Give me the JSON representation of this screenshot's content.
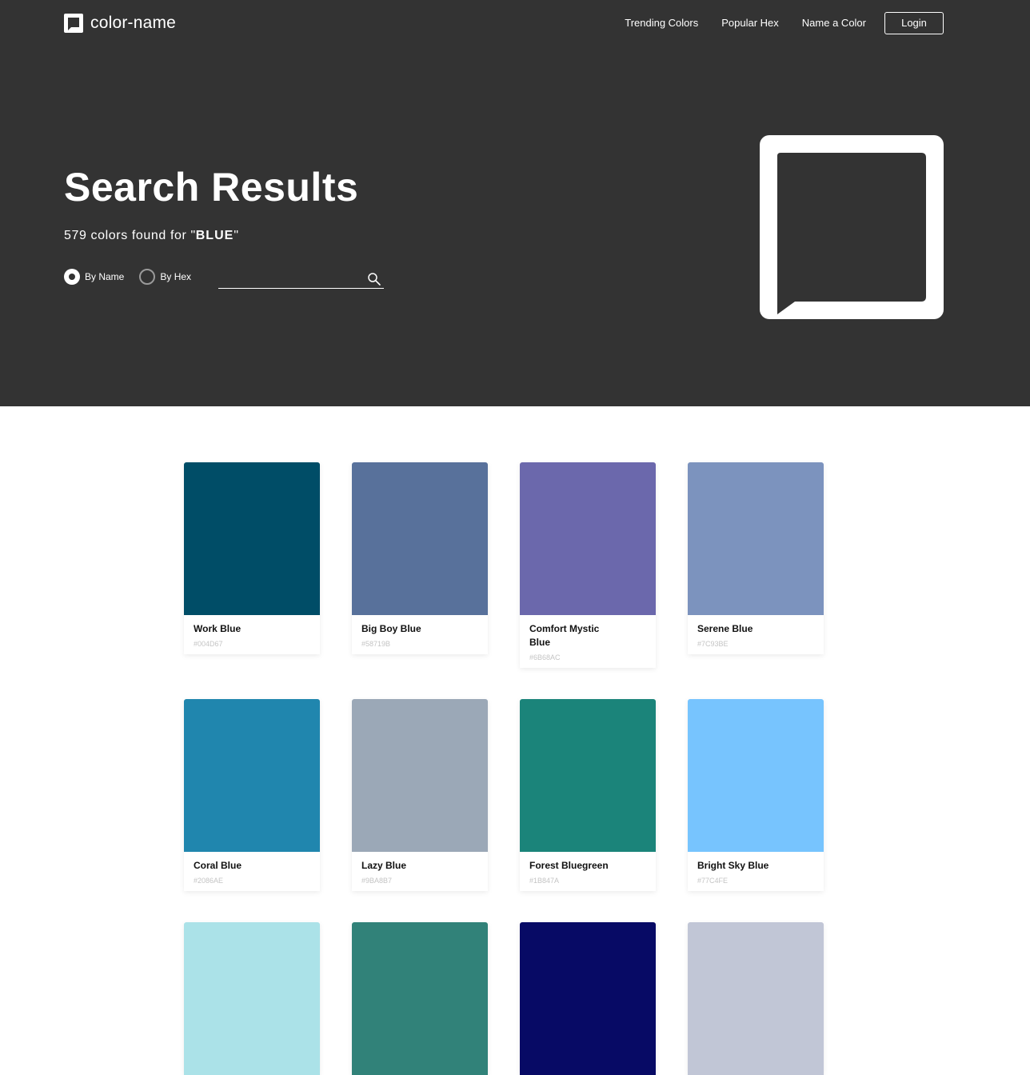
{
  "header": {
    "brand": "color-name",
    "nav": [
      "Trending Colors",
      "Popular Hex",
      "Name a Color"
    ],
    "login_label": "Login"
  },
  "hero": {
    "title": "Search Results",
    "summary_prefix": "579 colors found for \"",
    "query": "BLUE",
    "summary_suffix": "\"",
    "mode_options": [
      "By Name",
      "By Hex"
    ],
    "selected_mode": "By Name",
    "search_value": "",
    "search_placeholder": ""
  },
  "colors": [
    {
      "name": "Work Blue",
      "hex": "#004D67",
      "swatch": "#004d67"
    },
    {
      "name": "Big Boy Blue",
      "hex": "#58719B",
      "swatch": "#58719b"
    },
    {
      "name": "Comfort Mystic Blue",
      "hex": "#6B68AC",
      "swatch": "#6b68ac"
    },
    {
      "name": "Serene Blue",
      "hex": "#7C93BE",
      "swatch": "#7c93be"
    },
    {
      "name": "Coral Blue",
      "hex": "#2086AE",
      "swatch": "#2086ae"
    },
    {
      "name": "Lazy Blue",
      "hex": "#9BA8B7",
      "swatch": "#9ba8b7"
    },
    {
      "name": "Forest Bluegreen",
      "hex": "#1B847A",
      "swatch": "#1b847a"
    },
    {
      "name": "Bright Sky Blue",
      "hex": "#77C4FE",
      "swatch": "#77c4fe"
    },
    {
      "name": "",
      "hex": "",
      "swatch": "#abe2e8"
    },
    {
      "name": "",
      "hex": "",
      "swatch": "#318279"
    },
    {
      "name": "",
      "hex": "",
      "swatch": "#070a65"
    },
    {
      "name": "",
      "hex": "",
      "swatch": "#c1c6d6"
    }
  ],
  "theme": {
    "hero_bg": "#333333",
    "page_bg": "#ffffff"
  },
  "icons": {
    "brand": "chat-bubble-icon",
    "search": "search-icon",
    "hero": "chat-bubble-icon"
  }
}
